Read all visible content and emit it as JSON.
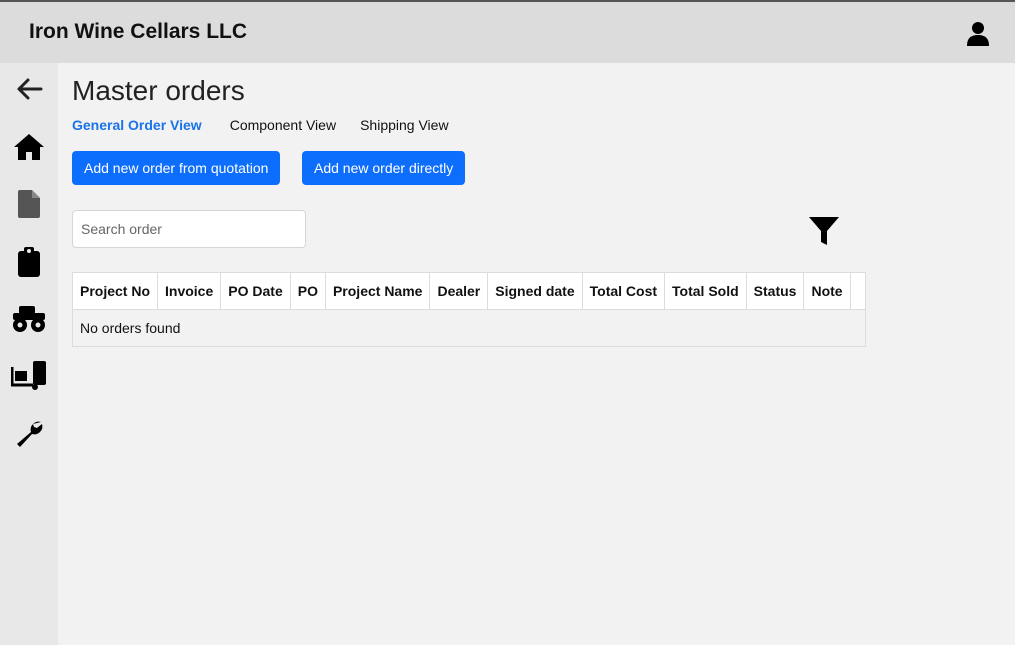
{
  "header": {
    "company_name": "Iron Wine Cellars LLC",
    "user_icon": "user-icon"
  },
  "sidebar": {
    "items": [
      {
        "icon": "back-arrow-icon"
      },
      {
        "icon": "home-icon"
      },
      {
        "icon": "document-icon"
      },
      {
        "icon": "clipboard-icon"
      },
      {
        "icon": "monster-truck-icon"
      },
      {
        "icon": "dolly-icon"
      },
      {
        "icon": "wrench-icon"
      }
    ]
  },
  "main": {
    "title": "Master orders",
    "tabs": [
      {
        "label": "General Order View",
        "active": true
      },
      {
        "label": "Component View",
        "active": false
      },
      {
        "label": "Shipping View",
        "active": false
      }
    ],
    "buttons": {
      "from_quotation": "Add new order from quotation",
      "directly": "Add new order directly"
    },
    "search": {
      "placeholder": "Search order",
      "value": ""
    },
    "filter_icon": "filter-icon",
    "table": {
      "columns": [
        "Project No",
        "Invoice",
        "PO Date",
        "PO",
        "Project Name",
        "Dealer",
        "Signed date",
        "Total Cost",
        "Total Sold",
        "Status",
        "Note",
        ""
      ],
      "empty_message": "No orders found"
    }
  },
  "colors": {
    "accent": "#0d6efd",
    "active_tab": "#1a73e8",
    "topbar": "#dcdcdc",
    "sidebar": "#e8e8e8"
  }
}
